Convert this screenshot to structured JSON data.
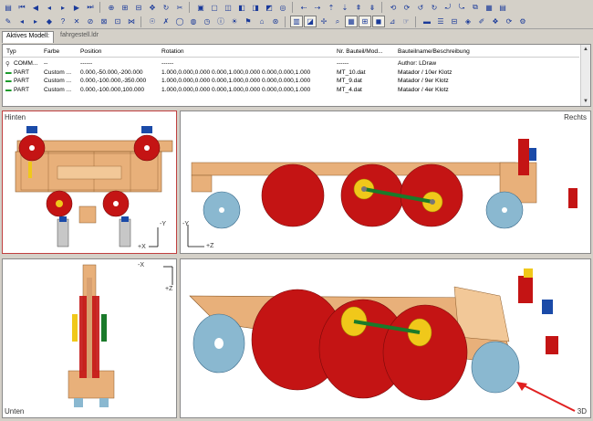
{
  "tabs": [
    {
      "label": "Aktives Modell:"
    },
    {
      "label": "fahrgestell.ldr"
    }
  ],
  "table": {
    "headers": [
      "Typ",
      "Farbe",
      "Position",
      "Rotation",
      "Nr. Bauteil/Mod...",
      "Bauteilname/Beschreibung"
    ],
    "rows": [
      [
        "Typ",
        "Farbe",
        "Position",
        "Rotation",
        "Nr. Bauteil/Mod...",
        "Bauteilname/Beschreibung"
      ],
      [
        "COMM...",
        "--",
        "------",
        "------",
        "------",
        "Author: LDraw"
      ],
      [
        "PART",
        "Custom ...",
        "0.000,-50.000,-200.000",
        "1.000,0.000,0.000 0.000,1.000,0.000 0.000,0.000,1.000",
        "MT_10.dat",
        "Matador / 10er Klotz"
      ],
      [
        "PART",
        "Custom ...",
        "0.000,-100.000,-350.000",
        "1.000,0.000,0.000 0.000,1.000,0.000 0.000,0.000,1.000",
        "MT_9.dat",
        "Matador / 9er Klotz"
      ],
      [
        "PART",
        "Custom ...",
        "0.000,-100.000,100.000",
        "1.000,0.000,0.000 0.000,1.000,0.000 0.000,0.000,1.000",
        "MT_4.dat",
        "Matador / 4er Klotz"
      ]
    ]
  },
  "viewports": {
    "top_left": {
      "label": "Hinten",
      "axis_y": "-Y",
      "axis_x": "+X"
    },
    "top_right": {
      "label": "Rechts",
      "axis_y": "-Y",
      "axis_x": "+Z"
    },
    "bottom_left": {
      "label": "Unten",
      "axis_x": "-X",
      "axis_y": "+Z"
    },
    "bottom_right": {
      "label": "3D"
    }
  },
  "toolbar_icons": [
    "first-icon",
    "prev-icon",
    "back-icon",
    "fwd-icon",
    "next-icon",
    "last-icon",
    "zoom-icon",
    "zoom-in-icon",
    "zoom-out-icon",
    "pan-icon",
    "rotate-icon",
    "render-icon",
    "grid-icon",
    "snap-icon"
  ],
  "colors": {
    "red": "#c41414",
    "wood": "#e8b07a",
    "yellow": "#f0c81a",
    "blue": "#1a4aa8",
    "lightblue": "#8ab8d0",
    "selected": "#c04040"
  }
}
